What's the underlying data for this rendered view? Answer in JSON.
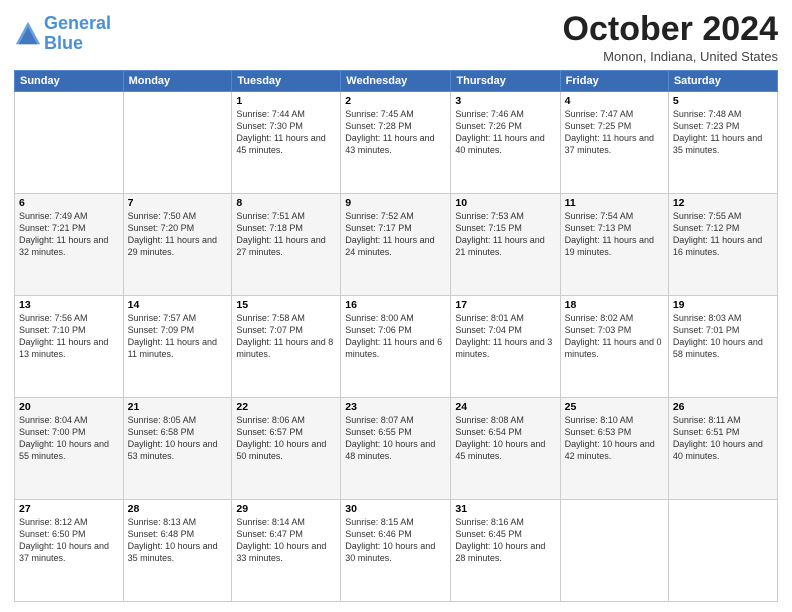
{
  "header": {
    "title": "October 2024",
    "location": "Monon, Indiana, United States",
    "logo_line1": "General",
    "logo_line2": "Blue"
  },
  "weekdays": [
    "Sunday",
    "Monday",
    "Tuesday",
    "Wednesday",
    "Thursday",
    "Friday",
    "Saturday"
  ],
  "weeks": [
    [
      {
        "day": "",
        "sunrise": "",
        "sunset": "",
        "daylight": ""
      },
      {
        "day": "",
        "sunrise": "",
        "sunset": "",
        "daylight": ""
      },
      {
        "day": "1",
        "sunrise": "Sunrise: 7:44 AM",
        "sunset": "Sunset: 7:30 PM",
        "daylight": "Daylight: 11 hours and 45 minutes."
      },
      {
        "day": "2",
        "sunrise": "Sunrise: 7:45 AM",
        "sunset": "Sunset: 7:28 PM",
        "daylight": "Daylight: 11 hours and 43 minutes."
      },
      {
        "day": "3",
        "sunrise": "Sunrise: 7:46 AM",
        "sunset": "Sunset: 7:26 PM",
        "daylight": "Daylight: 11 hours and 40 minutes."
      },
      {
        "day": "4",
        "sunrise": "Sunrise: 7:47 AM",
        "sunset": "Sunset: 7:25 PM",
        "daylight": "Daylight: 11 hours and 37 minutes."
      },
      {
        "day": "5",
        "sunrise": "Sunrise: 7:48 AM",
        "sunset": "Sunset: 7:23 PM",
        "daylight": "Daylight: 11 hours and 35 minutes."
      }
    ],
    [
      {
        "day": "6",
        "sunrise": "Sunrise: 7:49 AM",
        "sunset": "Sunset: 7:21 PM",
        "daylight": "Daylight: 11 hours and 32 minutes."
      },
      {
        "day": "7",
        "sunrise": "Sunrise: 7:50 AM",
        "sunset": "Sunset: 7:20 PM",
        "daylight": "Daylight: 11 hours and 29 minutes."
      },
      {
        "day": "8",
        "sunrise": "Sunrise: 7:51 AM",
        "sunset": "Sunset: 7:18 PM",
        "daylight": "Daylight: 11 hours and 27 minutes."
      },
      {
        "day": "9",
        "sunrise": "Sunrise: 7:52 AM",
        "sunset": "Sunset: 7:17 PM",
        "daylight": "Daylight: 11 hours and 24 minutes."
      },
      {
        "day": "10",
        "sunrise": "Sunrise: 7:53 AM",
        "sunset": "Sunset: 7:15 PM",
        "daylight": "Daylight: 11 hours and 21 minutes."
      },
      {
        "day": "11",
        "sunrise": "Sunrise: 7:54 AM",
        "sunset": "Sunset: 7:13 PM",
        "daylight": "Daylight: 11 hours and 19 minutes."
      },
      {
        "day": "12",
        "sunrise": "Sunrise: 7:55 AM",
        "sunset": "Sunset: 7:12 PM",
        "daylight": "Daylight: 11 hours and 16 minutes."
      }
    ],
    [
      {
        "day": "13",
        "sunrise": "Sunrise: 7:56 AM",
        "sunset": "Sunset: 7:10 PM",
        "daylight": "Daylight: 11 hours and 13 minutes."
      },
      {
        "day": "14",
        "sunrise": "Sunrise: 7:57 AM",
        "sunset": "Sunset: 7:09 PM",
        "daylight": "Daylight: 11 hours and 11 minutes."
      },
      {
        "day": "15",
        "sunrise": "Sunrise: 7:58 AM",
        "sunset": "Sunset: 7:07 PM",
        "daylight": "Daylight: 11 hours and 8 minutes."
      },
      {
        "day": "16",
        "sunrise": "Sunrise: 8:00 AM",
        "sunset": "Sunset: 7:06 PM",
        "daylight": "Daylight: 11 hours and 6 minutes."
      },
      {
        "day": "17",
        "sunrise": "Sunrise: 8:01 AM",
        "sunset": "Sunset: 7:04 PM",
        "daylight": "Daylight: 11 hours and 3 minutes."
      },
      {
        "day": "18",
        "sunrise": "Sunrise: 8:02 AM",
        "sunset": "Sunset: 7:03 PM",
        "daylight": "Daylight: 11 hours and 0 minutes."
      },
      {
        "day": "19",
        "sunrise": "Sunrise: 8:03 AM",
        "sunset": "Sunset: 7:01 PM",
        "daylight": "Daylight: 10 hours and 58 minutes."
      }
    ],
    [
      {
        "day": "20",
        "sunrise": "Sunrise: 8:04 AM",
        "sunset": "Sunset: 7:00 PM",
        "daylight": "Daylight: 10 hours and 55 minutes."
      },
      {
        "day": "21",
        "sunrise": "Sunrise: 8:05 AM",
        "sunset": "Sunset: 6:58 PM",
        "daylight": "Daylight: 10 hours and 53 minutes."
      },
      {
        "day": "22",
        "sunrise": "Sunrise: 8:06 AM",
        "sunset": "Sunset: 6:57 PM",
        "daylight": "Daylight: 10 hours and 50 minutes."
      },
      {
        "day": "23",
        "sunrise": "Sunrise: 8:07 AM",
        "sunset": "Sunset: 6:55 PM",
        "daylight": "Daylight: 10 hours and 48 minutes."
      },
      {
        "day": "24",
        "sunrise": "Sunrise: 8:08 AM",
        "sunset": "Sunset: 6:54 PM",
        "daylight": "Daylight: 10 hours and 45 minutes."
      },
      {
        "day": "25",
        "sunrise": "Sunrise: 8:10 AM",
        "sunset": "Sunset: 6:53 PM",
        "daylight": "Daylight: 10 hours and 42 minutes."
      },
      {
        "day": "26",
        "sunrise": "Sunrise: 8:11 AM",
        "sunset": "Sunset: 6:51 PM",
        "daylight": "Daylight: 10 hours and 40 minutes."
      }
    ],
    [
      {
        "day": "27",
        "sunrise": "Sunrise: 8:12 AM",
        "sunset": "Sunset: 6:50 PM",
        "daylight": "Daylight: 10 hours and 37 minutes."
      },
      {
        "day": "28",
        "sunrise": "Sunrise: 8:13 AM",
        "sunset": "Sunset: 6:48 PM",
        "daylight": "Daylight: 10 hours and 35 minutes."
      },
      {
        "day": "29",
        "sunrise": "Sunrise: 8:14 AM",
        "sunset": "Sunset: 6:47 PM",
        "daylight": "Daylight: 10 hours and 33 minutes."
      },
      {
        "day": "30",
        "sunrise": "Sunrise: 8:15 AM",
        "sunset": "Sunset: 6:46 PM",
        "daylight": "Daylight: 10 hours and 30 minutes."
      },
      {
        "day": "31",
        "sunrise": "Sunrise: 8:16 AM",
        "sunset": "Sunset: 6:45 PM",
        "daylight": "Daylight: 10 hours and 28 minutes."
      },
      {
        "day": "",
        "sunrise": "",
        "sunset": "",
        "daylight": ""
      },
      {
        "day": "",
        "sunrise": "",
        "sunset": "",
        "daylight": ""
      }
    ]
  ]
}
